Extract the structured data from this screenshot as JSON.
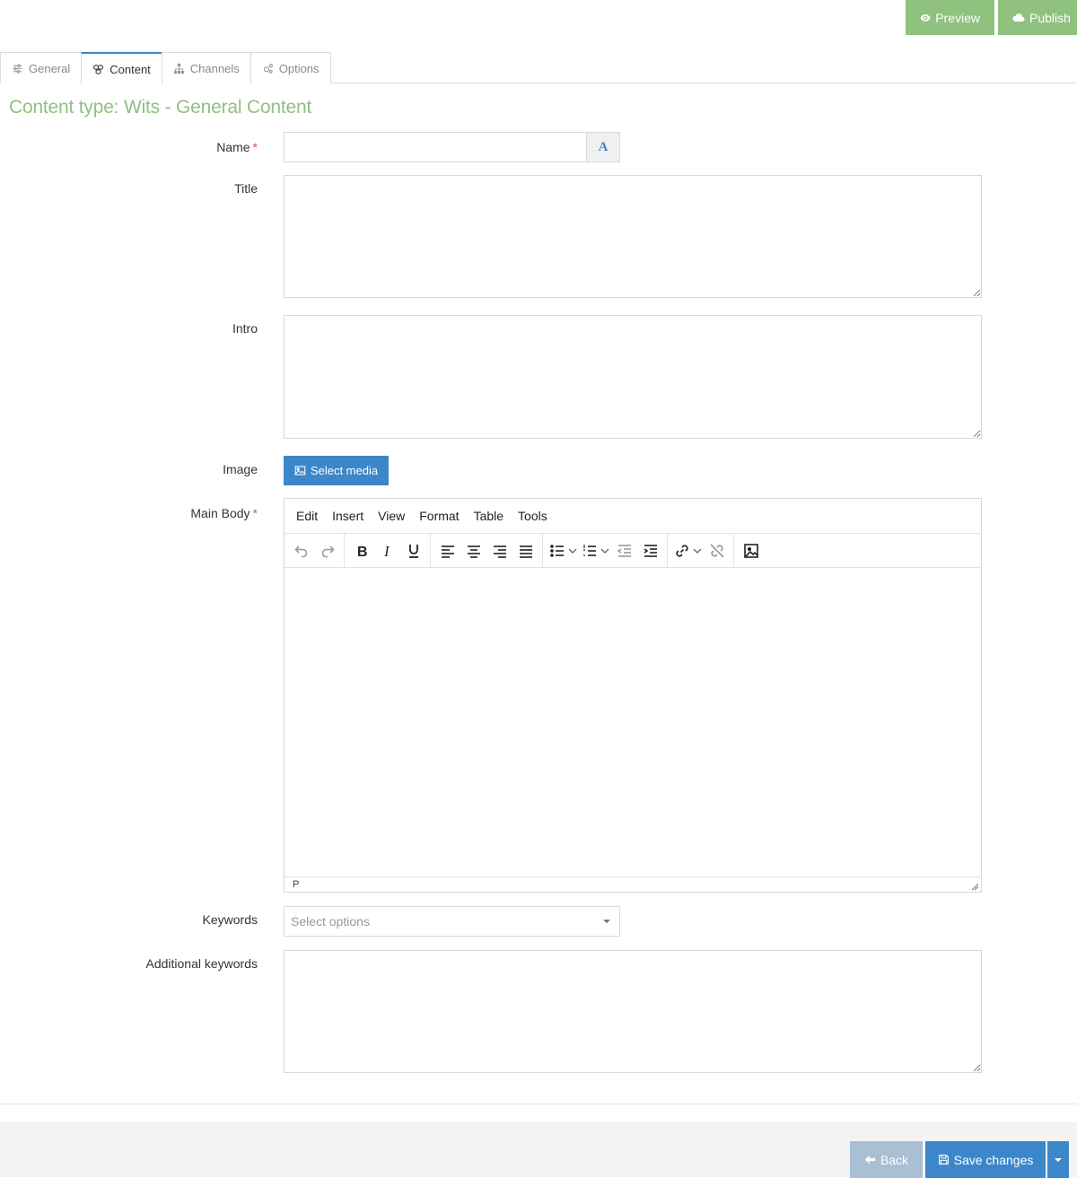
{
  "toolbar": {
    "preview_label": "Preview",
    "publish_label": "Publish"
  },
  "tabs": [
    {
      "label": "General",
      "icon": "sliders-icon"
    },
    {
      "label": "Content",
      "icon": "cubes-icon",
      "active": true
    },
    {
      "label": "Channels",
      "icon": "sitemap-icon"
    },
    {
      "label": "Options",
      "icon": "gears-icon"
    }
  ],
  "heading": "Content type: Wits - General Content",
  "fields": {
    "name": {
      "label": "Name",
      "required": "*",
      "value": "",
      "addon_glyph": "A"
    },
    "title": {
      "label": "Title",
      "value": ""
    },
    "intro": {
      "label": "Intro",
      "value": ""
    },
    "image": {
      "label": "Image",
      "button": "Select media"
    },
    "main_body": {
      "label": "Main Body",
      "required": "*"
    },
    "keywords": {
      "label": "Keywords",
      "placeholder": "Select options"
    },
    "additional_keywords": {
      "label": "Additional keywords",
      "value": ""
    }
  },
  "editor": {
    "menu": [
      "Edit",
      "Insert",
      "View",
      "Format",
      "Table",
      "Tools"
    ],
    "status_path": "P"
  },
  "footer": {
    "back_label": "Back",
    "save_label": "Save changes"
  },
  "colors": {
    "green": "#8fc17f",
    "blue": "#3b87c9",
    "back_disabled": "#a9bfd4",
    "required": "#d9534f"
  }
}
